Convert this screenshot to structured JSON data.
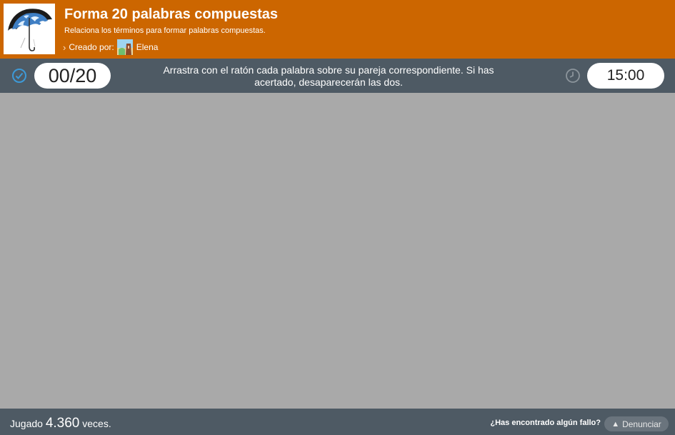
{
  "header": {
    "thumbnail_icon": "umbrella-icon",
    "title": "Forma 20 palabras compuestas",
    "subtitle": "Relaciona los términos para formar palabras compuestas.",
    "creator_prefix": "Creado por:",
    "creator_name": "Elena",
    "accent_color": "#cc6600"
  },
  "status": {
    "score": "00/20",
    "instructions": "Arrastra con el ratón cada palabra sobre su pareja correspondiente. Si has acertado, desaparecerán las dos.",
    "timer": "15:00",
    "bar_color": "#4e5a64"
  },
  "board": {
    "background_color": "#a9a9a9"
  },
  "footer": {
    "played_prefix": "Jugado",
    "played_count": "4.360",
    "played_suffix": "veces.",
    "report_question": "¿Has encontrado algún fallo?",
    "report_label": "Denunciar",
    "report_icon": "warning-icon"
  }
}
